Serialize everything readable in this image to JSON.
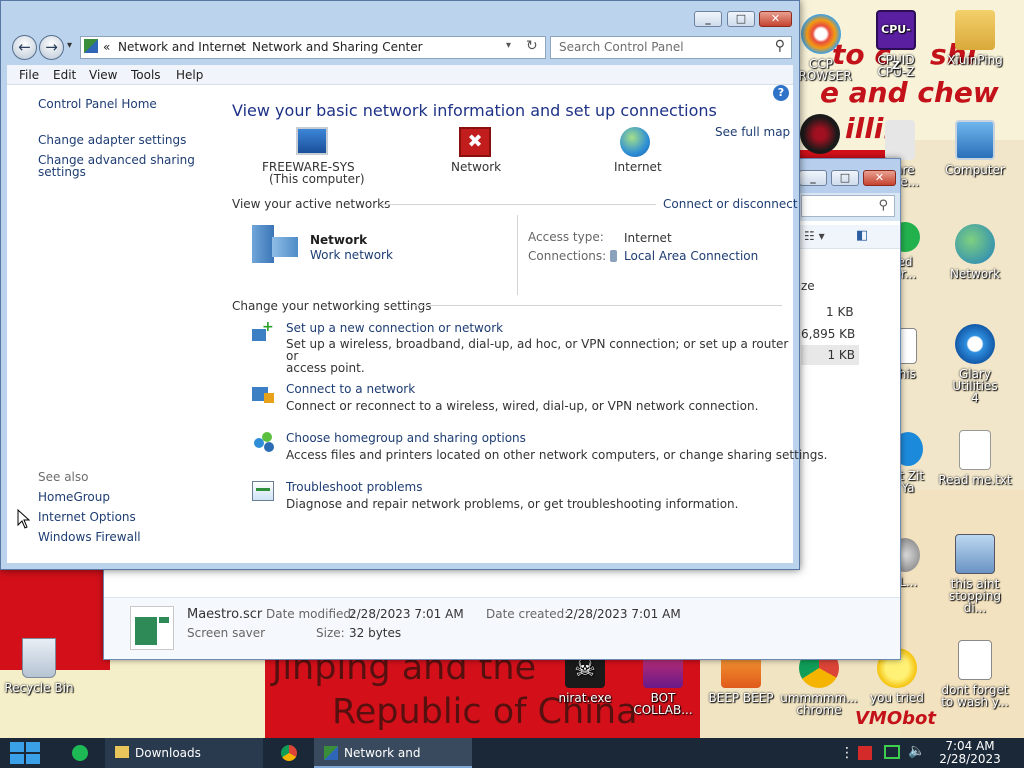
{
  "desktop": {
    "wallpaper_texts": [
      "to c",
      "shi",
      "e and chew",
      "illin",
      "Jinping and the",
      "Republic of China",
      "VMObot"
    ],
    "icons": [
      {
        "name": "ccp-browser-icon",
        "label": "CCP\nBROWSER"
      },
      {
        "name": "cpuid-icon",
        "label": "CPUID\nCPU-Z"
      },
      {
        "name": "xiuping-icon",
        "label": "XiuinPing"
      },
      {
        "name": "computer-icon",
        "label": "Computer"
      },
      {
        "name": "network-icon",
        "label": "Network"
      },
      {
        "name": "glary-icon",
        "label": "Glary Utilities\n4"
      },
      {
        "name": "readme-icon",
        "label": "Read me.txt"
      },
      {
        "name": "this-aint-icon",
        "label": "this aint\nstopping di..."
      },
      {
        "name": "dont-forget-icon",
        "label": "dont forget\nto wash y..."
      },
      {
        "name": "you-tried-icon",
        "label": "you tried"
      },
      {
        "name": "chrome-icon",
        "label": "ummmmm...\nchrome"
      },
      {
        "name": "beep-icon",
        "label": "BEEP BEEP"
      },
      {
        "name": "bot-icon",
        "label": "BOT\nCOLLAB..."
      },
      {
        "name": "nirat-icon",
        "label": "nirat.exe"
      },
      {
        "name": "recycle-icon",
        "label": "Recycle Bin"
      },
      {
        "name": "partial-1-icon",
        "label": "ware\nnote..."
      },
      {
        "name": "partial-2-icon",
        "label": "ed\ner..."
      },
      {
        "name": "partial-3-icon",
        "label": "this"
      },
      {
        "name": "partial-4-icon",
        "label": "at Zit\nYa"
      },
      {
        "name": "partial-5-icon",
        "label": "LL..."
      }
    ]
  },
  "bg_window": {
    "sizes": [
      "ze",
      "1 KB",
      "6,895 KB",
      "1 KB"
    ],
    "footer": {
      "file_name": "Maestro.scr",
      "file_type": "Screen saver",
      "modified_label": "Date modified:",
      "modified_value": "2/28/2023 7:01 AM",
      "created_label": "Date created:",
      "created_value": "2/28/2023 7:01 AM",
      "size_label": "Size:",
      "size_value": "32 bytes"
    }
  },
  "window": {
    "breadcrumb_prefix": "«",
    "breadcrumb": [
      "Network and Internet",
      "Network and Sharing Center"
    ],
    "search_placeholder": "Search Control Panel",
    "menu": [
      "File",
      "Edit",
      "View",
      "Tools",
      "Help"
    ],
    "sidebar": {
      "links": [
        "Control Panel Home",
        "Change adapter settings",
        "Change advanced sharing settings"
      ],
      "see_also_header": "See also",
      "see_also": [
        "HomeGroup",
        "Internet Options",
        "Windows Firewall"
      ]
    },
    "main": {
      "title": "View your basic network information and set up connections",
      "see_full_map": "See full map",
      "map": {
        "computer_name": "FREEWARE-SYS",
        "computer_sub": "(This computer)",
        "network_label": "Network",
        "internet_label": "Internet"
      },
      "active_header": "View your active networks",
      "connect_link": "Connect or disconnect",
      "active_network": {
        "name": "Network",
        "type": "Work network",
        "access_type_label": "Access type:",
        "access_type_value": "Internet",
        "connections_label": "Connections:",
        "connections_value": "Local Area Connection"
      },
      "settings_header": "Change your networking settings",
      "tasks": [
        {
          "title": "Set up a new connection or network",
          "desc": "Set up a wireless, broadband, dial-up, ad hoc, or VPN connection; or set up a router or\naccess point."
        },
        {
          "title": "Connect to a network",
          "desc": "Connect or reconnect to a wireless, wired, dial-up, or VPN network connection."
        },
        {
          "title": "Choose homegroup and sharing options",
          "desc": "Access files and printers located on other network computers, or change sharing settings."
        },
        {
          "title": "Troubleshoot problems",
          "desc": "Diagnose and repair network problems, or get troubleshooting information."
        }
      ]
    }
  },
  "taskbar": {
    "items": [
      "Downloads",
      "Network and Sharin..."
    ],
    "time": "7:04 AM",
    "date": "2/28/2023"
  }
}
